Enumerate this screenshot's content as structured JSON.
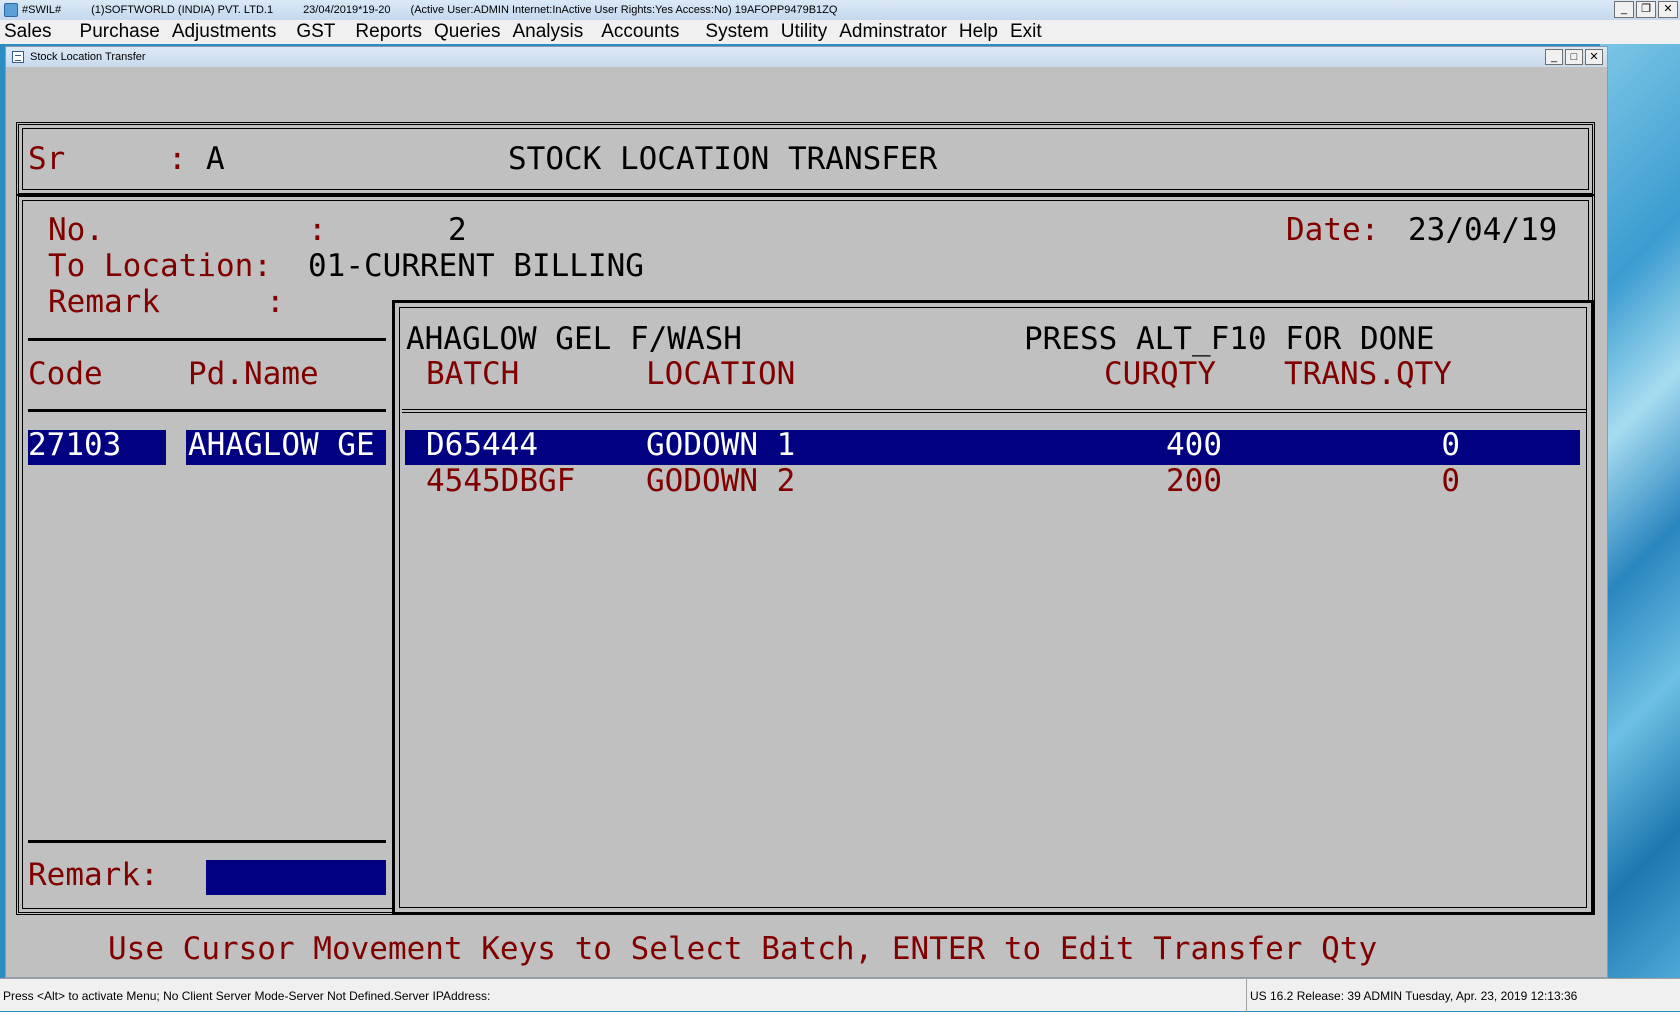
{
  "titlebar": {
    "app": "#SWIL#",
    "company": "(1)SOFTWORLD (INDIA) PVT. LTD.1",
    "date_period": "23/04/2019*19-20",
    "user_info": "(Active User:ADMIN Internet:InActive User Rights:Yes Access:No) 19AFOPP9479B1ZQ",
    "minimize": "_",
    "restore": "❐",
    "close": "✕"
  },
  "menu": [
    "Sales",
    "Purchase",
    "Adjustments",
    "GST",
    "Reports",
    "Queries",
    "Analysis",
    "Accounts",
    "System",
    "Utility",
    "Adminstrator",
    "Help",
    "Exit"
  ],
  "child_window": {
    "title": "Stock Location Transfer",
    "minimize": "_",
    "restore": "□",
    "close": "✕"
  },
  "header": {
    "sr_label": "Sr",
    "sr_sep": ":",
    "sr_value": "A",
    "form_title": "STOCK LOCATION TRANSFER"
  },
  "form": {
    "no_label": "No.",
    "no_sep": ":",
    "no_value": "2",
    "date_label": "Date:",
    "date_value": "23/04/19",
    "to_location_label": "To Location:",
    "to_location_value": "01-CURRENT BILLING",
    "remark_label": "Remark",
    "remark_sep": ":"
  },
  "grid": {
    "columns": [
      "Code",
      "Pd.Name"
    ],
    "rows": [
      {
        "code": "27103",
        "name": "AHAGLOW GE"
      }
    ],
    "remark_label": "Remark:",
    "remark_value": ""
  },
  "popup": {
    "product": "AHAGLOW GEL F/WASH",
    "hint": "PRESS ALT_F10 FOR DONE",
    "columns": [
      "BATCH",
      "LOCATION",
      "CURQTY",
      "TRANS.QTY"
    ],
    "rows": [
      {
        "batch": "D65444",
        "location": "GODOWN 1",
        "curqty": "400",
        "transqty": "0",
        "selected": true
      },
      {
        "batch": "4545DBGF",
        "location": "GODOWN 2",
        "curqty": "200",
        "transqty": "0",
        "selected": false
      }
    ]
  },
  "instruction": "Use Cursor Movement Keys to Select Batch, ENTER to Edit Transfer Qty",
  "statusbar": {
    "left": "Press <Alt> to activate Menu; No Client Server Mode-Server Not Defined.Server IPAddress:",
    "right": "US 16.2 Release: 39  ADMIN  Tuesday, Apr. 23, 2019  12:13:36"
  }
}
